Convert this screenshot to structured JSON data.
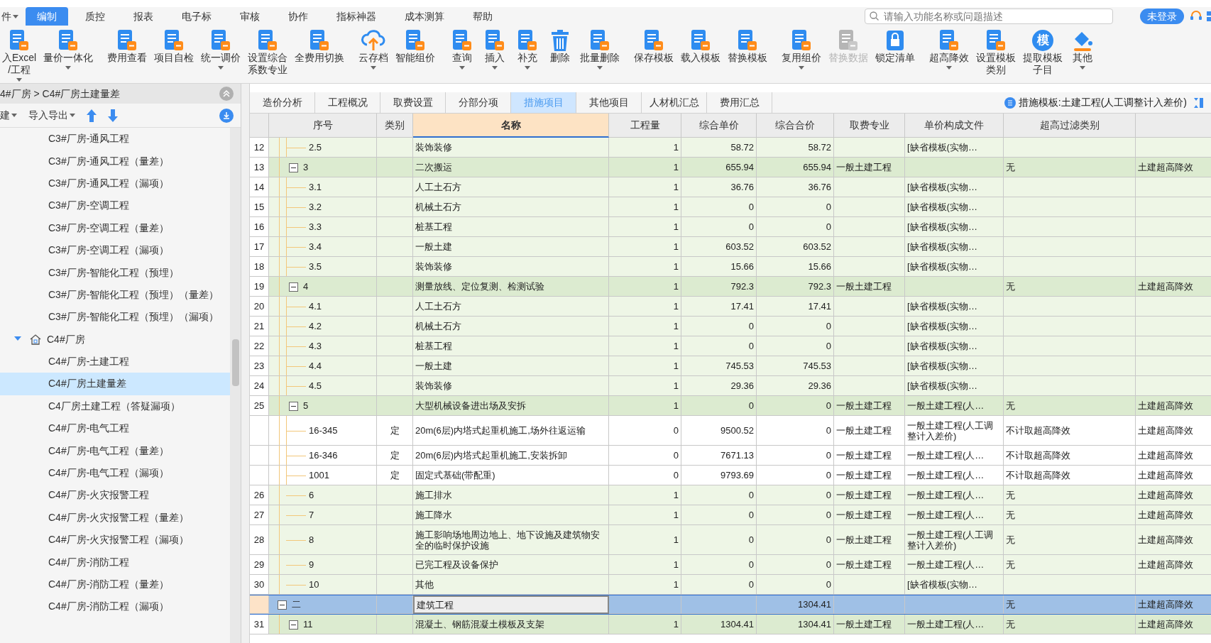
{
  "menu": {
    "items": [
      {
        "label": "件",
        "dropdown": true,
        "selected": false
      },
      {
        "label": "编制",
        "dropdown": false,
        "selected": true
      },
      {
        "label": "质控",
        "dropdown": false,
        "selected": false
      },
      {
        "label": "报表",
        "dropdown": false,
        "selected": false
      },
      {
        "label": "电子标",
        "dropdown": false,
        "selected": false
      },
      {
        "label": "审核",
        "dropdown": false,
        "selected": false
      },
      {
        "label": "协作",
        "dropdown": false,
        "selected": false
      },
      {
        "label": "指标神器",
        "dropdown": false,
        "selected": false
      },
      {
        "label": "成本测算",
        "dropdown": false,
        "selected": false
      },
      {
        "label": "帮助",
        "dropdown": false,
        "selected": false
      }
    ],
    "search": {
      "placeholder": "请输入功能名称或问题描述"
    },
    "login_button": "未登录"
  },
  "ribbon": {
    "groups": [
      [
        {
          "lines": [
            "入Excel",
            "/工程"
          ],
          "dropdown": true,
          "disabled": false
        },
        {
          "lines": [
            "量价一体化"
          ],
          "dropdown": true,
          "disabled": false
        }
      ],
      [
        {
          "lines": [
            "费用查看"
          ],
          "dropdown": false,
          "disabled": false
        },
        {
          "lines": [
            "项目自检"
          ],
          "dropdown": false,
          "disabled": false
        },
        {
          "lines": [
            "统一调价"
          ],
          "dropdown": true,
          "disabled": false
        },
        {
          "lines": [
            "设置综合",
            "系数专业"
          ],
          "dropdown": false,
          "disabled": false
        },
        {
          "lines": [
            "全费用切换"
          ],
          "dropdown": false,
          "disabled": false
        }
      ],
      [
        {
          "lines": [
            "云存档"
          ],
          "dropdown": true,
          "disabled": false
        },
        {
          "lines": [
            "智能组价"
          ],
          "dropdown": false,
          "disabled": false
        }
      ],
      [
        {
          "lines": [
            "查询"
          ],
          "dropdown": true,
          "disabled": false
        },
        {
          "lines": [
            "插入"
          ],
          "dropdown": true,
          "disabled": false
        },
        {
          "lines": [
            "补充"
          ],
          "dropdown": true,
          "disabled": false
        },
        {
          "lines": [
            "删除"
          ],
          "dropdown": false,
          "disabled": false
        },
        {
          "lines": [
            "批量删除"
          ],
          "dropdown": true,
          "disabled": false
        }
      ],
      [
        {
          "lines": [
            "保存模板"
          ],
          "dropdown": false,
          "disabled": false
        },
        {
          "lines": [
            "载入模板"
          ],
          "dropdown": false,
          "disabled": false
        },
        {
          "lines": [
            "替换模板"
          ],
          "dropdown": false,
          "disabled": false
        }
      ],
      [
        {
          "lines": [
            "复用组价"
          ],
          "dropdown": true,
          "disabled": false
        },
        {
          "lines": [
            "替换数据"
          ],
          "dropdown": false,
          "disabled": true
        },
        {
          "lines": [
            "锁定清单"
          ],
          "dropdown": false,
          "disabled": false
        }
      ],
      [
        {
          "lines": [
            "超高降效"
          ],
          "dropdown": true,
          "disabled": false
        },
        {
          "lines": [
            "设置模板",
            "类别"
          ],
          "dropdown": false,
          "disabled": false
        },
        {
          "lines": [
            "提取模板",
            "子目"
          ],
          "dropdown": false,
          "disabled": false,
          "glyph": "模"
        },
        {
          "lines": [
            "其他"
          ],
          "dropdown": true,
          "disabled": false
        }
      ]
    ]
  },
  "sidebar": {
    "breadcrumb": "4#厂房 > C4#厂房土建量差",
    "tools": [
      {
        "label": "建",
        "dropdown": true
      },
      {
        "label": "导入导出",
        "dropdown": true
      }
    ],
    "tree": [
      {
        "label": "C3#厂房-通风工程",
        "selected": false
      },
      {
        "label": "C3#厂房-通风工程（量差）",
        "selected": false
      },
      {
        "label": "C3#厂房-通风工程（漏项）",
        "selected": false
      },
      {
        "label": "C3#厂房-空调工程",
        "selected": false
      },
      {
        "label": "C3#厂房-空调工程（量差）",
        "selected": false
      },
      {
        "label": "C3#厂房-空调工程（漏项）",
        "selected": false
      },
      {
        "label": "C3#厂房-智能化工程（预埋）",
        "selected": false
      },
      {
        "label": "C3#厂房-智能化工程（预埋）（量差）",
        "selected": false
      },
      {
        "label": "C3#厂房-智能化工程（预埋）（漏项）",
        "selected": false
      },
      {
        "label": "C4#厂房",
        "selected": false,
        "expanded": true,
        "children": [
          {
            "label": "C4#厂房-土建工程",
            "selected": false
          },
          {
            "label": "C4#厂房土建量差",
            "selected": true
          },
          {
            "label": "C4厂房土建工程（答疑漏项）",
            "selected": false
          },
          {
            "label": "C4#厂房-电气工程",
            "selected": false
          },
          {
            "label": "C4#厂房-电气工程（量差）",
            "selected": false
          },
          {
            "label": "C4#厂房-电气工程（漏项）",
            "selected": false
          },
          {
            "label": "C4#厂房-火灾报警工程",
            "selected": false
          },
          {
            "label": "C4#厂房-火灾报警工程（量差）",
            "selected": false
          },
          {
            "label": "C4#厂房-火灾报警工程（漏项）",
            "selected": false
          },
          {
            "label": "C4#厂房-消防工程",
            "selected": false
          },
          {
            "label": "C4#厂房-消防工程（量差）",
            "selected": false
          },
          {
            "label": "C4#厂房-消防工程（漏项）",
            "selected": false
          }
        ]
      }
    ]
  },
  "tabs": [
    {
      "label": "造价分析",
      "selected": false
    },
    {
      "label": "工程概况",
      "selected": false
    },
    {
      "label": "取费设置",
      "selected": false
    },
    {
      "label": "分部分项",
      "selected": false
    },
    {
      "label": "措施项目",
      "selected": true
    },
    {
      "label": "其他项目",
      "selected": false
    },
    {
      "label": "人材机汇总",
      "selected": false
    },
    {
      "label": "费用汇总",
      "selected": false
    }
  ],
  "template_label": "措施模板:土建工程(人工调整计入差价)",
  "table": {
    "columns": [
      "序号",
      "类别",
      "名称",
      "工程量",
      "综合单价",
      "综合合价",
      "取费专业",
      "单价构成文件",
      "超高过滤类别"
    ],
    "rows": [
      {
        "kind": "sub",
        "no": "12",
        "seq": "2.5",
        "name": "装饰装修",
        "qty": "1",
        "unit_price": "58.72",
        "total": "58.72",
        "file": "[缺省模板(实物…",
        "selected": false
      },
      {
        "kind": "group",
        "expanded": true,
        "no": "13",
        "seq": "3",
        "name": "二次搬运",
        "qty": "1",
        "unit_price": "655.94",
        "total": "655.94",
        "fee": "一般土建工程",
        "filter": "无",
        "column_10": "土建超高降效",
        "selected": false
      },
      {
        "kind": "sub",
        "no": "14",
        "seq": "3.1",
        "name": "人工土石方",
        "qty": "1",
        "unit_price": "36.76",
        "total": "36.76",
        "file": "[缺省模板(实物…",
        "selected": false
      },
      {
        "kind": "sub",
        "no": "15",
        "seq": "3.2",
        "name": "机械土石方",
        "qty": "1",
        "unit_price": "0",
        "total": "0",
        "file": "[缺省模板(实物…",
        "selected": false
      },
      {
        "kind": "sub",
        "no": "16",
        "seq": "3.3",
        "name": "桩基工程",
        "qty": "1",
        "unit_price": "0",
        "total": "0",
        "file": "[缺省模板(实物…",
        "selected": false
      },
      {
        "kind": "sub",
        "no": "17",
        "seq": "3.4",
        "name": "一般土建",
        "qty": "1",
        "unit_price": "603.52",
        "total": "603.52",
        "file": "[缺省模板(实物…",
        "selected": false
      },
      {
        "kind": "sub",
        "no": "18",
        "seq": "3.5",
        "name": "装饰装修",
        "qty": "1",
        "unit_price": "15.66",
        "total": "15.66",
        "file": "[缺省模板(实物…",
        "selected": false
      },
      {
        "kind": "group",
        "expanded": true,
        "no": "19",
        "seq": "4",
        "name": "测量放线、定位复测、检测试验",
        "qty": "1",
        "unit_price": "792.3",
        "total": "792.3",
        "fee": "一般土建工程",
        "filter": "无",
        "column_10": "土建超高降效",
        "selected": false
      },
      {
        "kind": "sub",
        "no": "20",
        "seq": "4.1",
        "name": "人工土石方",
        "qty": "1",
        "unit_price": "17.41",
        "total": "17.41",
        "file": "[缺省模板(实物…",
        "selected": false
      },
      {
        "kind": "sub",
        "no": "21",
        "seq": "4.2",
        "name": "机械土石方",
        "qty": "1",
        "unit_price": "0",
        "total": "0",
        "file": "[缺省模板(实物…",
        "selected": false
      },
      {
        "kind": "sub",
        "no": "22",
        "seq": "4.3",
        "name": "桩基工程",
        "qty": "1",
        "unit_price": "0",
        "total": "0",
        "file": "[缺省模板(实物…",
        "selected": false
      },
      {
        "kind": "sub",
        "no": "23",
        "seq": "4.4",
        "name": "一般土建",
        "qty": "1",
        "unit_price": "745.53",
        "total": "745.53",
        "file": "[缺省模板(实物…",
        "selected": false
      },
      {
        "kind": "sub",
        "no": "24",
        "seq": "4.5",
        "name": "装饰装修",
        "qty": "1",
        "unit_price": "29.36",
        "total": "29.36",
        "file": "[缺省模板(实物…",
        "selected": false
      },
      {
        "kind": "group",
        "expanded": true,
        "no": "25",
        "seq": "5",
        "name": "大型机械设备进出场及安拆",
        "qty": "1",
        "unit_price": "0",
        "total": "0",
        "fee": "一般土建工程",
        "file": "一般土建工程(人…",
        "filter": "无",
        "column_10": "土建超高降效",
        "selected": false
      },
      {
        "kind": "quota",
        "seq": "16-345",
        "type": "定",
        "name": "20m(6层)内塔式起重机施工,场外往返运输",
        "qty": "0",
        "unit_price": "9500.52",
        "total": "0",
        "fee": "一般土建工程",
        "file": "一般土建工程(人工调整计入差价)",
        "filter": "不计取超高降效",
        "column_10": "土建超高降效",
        "selected": false
      },
      {
        "kind": "quota",
        "seq": "16-346",
        "type": "定",
        "name": "20m(6层)内塔式起重机施工,安装拆卸",
        "qty": "0",
        "unit_price": "7671.13",
        "total": "0",
        "fee": "一般土建工程",
        "file": "一般土建工程(人…",
        "filter": "不计取超高降效",
        "column_10": "土建超高降效",
        "selected": false
      },
      {
        "kind": "quota",
        "seq": "1001",
        "type": "定",
        "name": "固定式基础(带配重)",
        "qty": "0",
        "unit_price": "9793.69",
        "total": "0",
        "fee": "一般土建工程",
        "file": "一般土建工程(人…",
        "filter": "不计取超高降效",
        "column_10": "土建超高降效",
        "selected": false
      },
      {
        "kind": "item",
        "no": "26",
        "seq": "6",
        "name": "施工排水",
        "qty": "1",
        "unit_price": "0",
        "total": "0",
        "fee": "一般土建工程",
        "file": "一般土建工程(人…",
        "filter": "无",
        "column_10": "土建超高降效",
        "selected": false
      },
      {
        "kind": "item",
        "no": "27",
        "seq": "7",
        "name": "施工降水",
        "qty": "1",
        "unit_price": "0",
        "total": "0",
        "fee": "一般土建工程",
        "file": "一般土建工程(人…",
        "filter": "无",
        "column_10": "土建超高降效",
        "selected": false
      },
      {
        "kind": "item",
        "no": "28",
        "seq": "8",
        "name": "施工影响场地周边地上、地下设施及建筑物安全的临时保护设施",
        "qty": "1",
        "unit_price": "0",
        "total": "0",
        "fee": "一般土建工程",
        "file": "一般土建工程(人工调整计入差价)",
        "filter": "无",
        "column_10": "土建超高降效",
        "selected": false
      },
      {
        "kind": "item",
        "no": "29",
        "seq": "9",
        "name": "已完工程及设备保护",
        "qty": "1",
        "unit_price": "0",
        "total": "0",
        "fee": "一般土建工程",
        "file": "一般土建工程(人…",
        "filter": "无",
        "column_10": "土建超高降效",
        "selected": false
      },
      {
        "kind": "item",
        "no": "30",
        "seq": "10",
        "name": "其他",
        "qty": "1",
        "unit_price": "0",
        "total": "0",
        "file": "[缺省模板(实物…",
        "selected": false
      },
      {
        "kind": "section",
        "expanded": true,
        "seq": "二",
        "name": "建筑工程",
        "total": "1304.41",
        "filter": "无",
        "column_10": "土建超高降效",
        "selected": true
      },
      {
        "kind": "group",
        "expanded": true,
        "no": "31",
        "seq": "11",
        "name": "混凝土、钢筋混凝土模板及支架",
        "qty": "1",
        "unit_price": "1304.41",
        "total": "1304.41",
        "fee": "一般土建工程",
        "file": "一般土建工程(人…",
        "filter": "无",
        "column_10": "土建超高降效",
        "selected": false
      }
    ]
  }
}
